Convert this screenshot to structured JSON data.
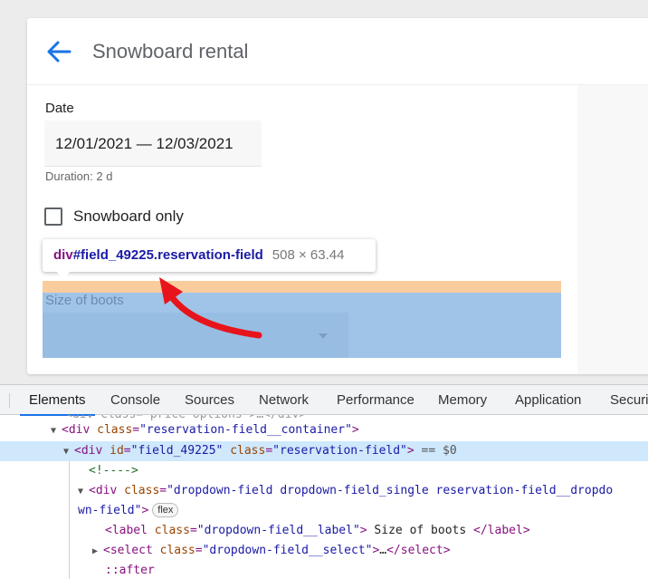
{
  "app": {
    "title": "Snowboard rental",
    "date_label": "Date",
    "date_value": "12/01/2021 — 12/03/2021",
    "duration": "Duration: 2 d",
    "checkbox_label": "Snowboard only",
    "boots_label": "Size of boots",
    "accent": "#1a73e8"
  },
  "tooltip": {
    "tag": "div",
    "ident": "#field_49225.reservation-field",
    "size": "508 × 63.44"
  },
  "devtools": {
    "tabs": [
      "Elements",
      "Console",
      "Sources",
      "Network",
      "Performance",
      "Memory",
      "Application",
      "Securi"
    ],
    "active_tab": "Elements",
    "lines": {
      "l0": "<div class=\"price-options\">…</div>",
      "l1_tag": "div",
      "l1_attr": "class",
      "l1_val": "\"reservation-field__container\"",
      "l2_tag": "div",
      "l2_attr1": "id",
      "l2_val1": "\"field_49225\"",
      "l2_attr2": "class",
      "l2_val2": "\"reservation-field\"",
      "l2_eq": "== $0",
      "l3_comment": "<!---->",
      "l4_tag": "div",
      "l4_attr": "class",
      "l4_val": "\"dropdown-field dropdown-field_single reservation-field__dropdo",
      "l5_val": "wn-field\"",
      "l5_badge": "flex",
      "l6_tag": "label",
      "l6_attr": "class",
      "l6_val": "\"dropdown-field__label\"",
      "l6_text": " Size of boots ",
      "l7_tag": "select",
      "l7_attr": "class",
      "l7_val": "\"dropdown-field__select\"",
      "l7_ellipsis": "…",
      "l8_pseudo": "::after"
    }
  }
}
